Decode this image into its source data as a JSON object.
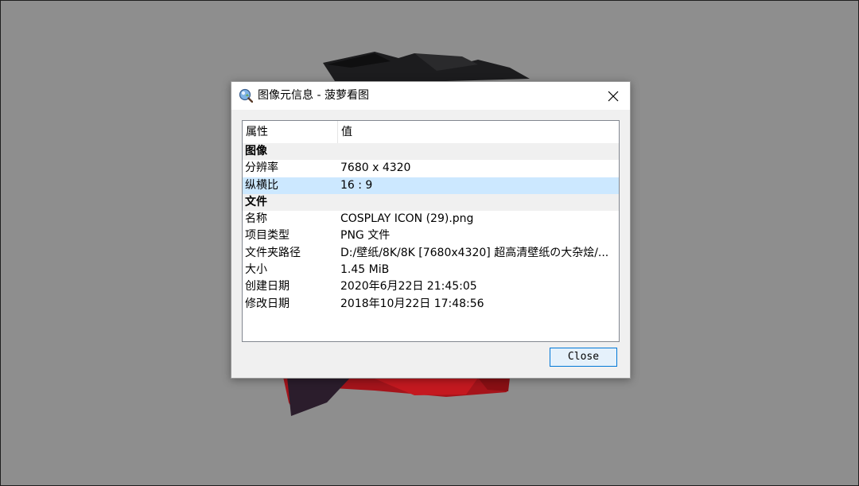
{
  "dialog": {
    "title": "图像元信息 - 菠萝看图",
    "close_icon": "close-icon",
    "app_icon": "magnifier-app-icon"
  },
  "table": {
    "headers": [
      "属性",
      "值"
    ],
    "rows": [
      {
        "type": "group",
        "key": "图像",
        "value": ""
      },
      {
        "type": "item",
        "key": "分辨率",
        "value": "7680 x 4320"
      },
      {
        "type": "item",
        "key": "纵横比",
        "value": "16 : 9",
        "selected": true
      },
      {
        "type": "group",
        "key": "文件",
        "value": ""
      },
      {
        "type": "item",
        "key": "名称",
        "value": "COSPLAY ICON (29).png"
      },
      {
        "type": "item",
        "key": "项目类型",
        "value": "PNG 文件"
      },
      {
        "type": "item",
        "key": "文件夹路径",
        "value": "D:/壁纸/8K/8K [7680x4320]  超高清壁纸の大杂烩/..."
      },
      {
        "type": "item",
        "key": "大小",
        "value": "1.45 MiB"
      },
      {
        "type": "item",
        "key": "创建日期",
        "value": "2020年6月22日 21:45:05"
      },
      {
        "type": "item",
        "key": "修改日期",
        "value": "2018年10月22日 17:48:56"
      }
    ]
  },
  "buttons": {
    "close_label": "Close"
  },
  "colors": {
    "selection": "#cce8ff",
    "group_row": "#f0f0f0",
    "button_border": "#0078d7",
    "overlay": "#8e8e8e"
  }
}
